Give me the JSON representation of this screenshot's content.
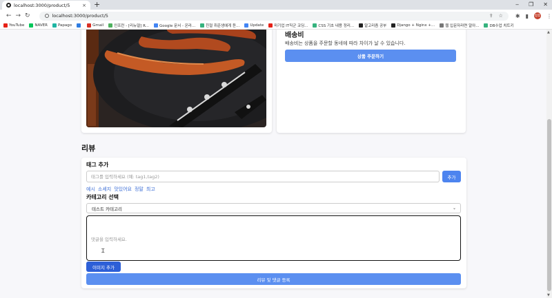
{
  "browser": {
    "tab_title": "localhost:3000/product/5",
    "tab_close": "×",
    "new_tab": "+",
    "url": "localhost:3000/product/5",
    "window_controls": [
      "‒",
      "❐",
      "✕"
    ],
    "profile_initials": "정후",
    "bookmarks": [
      {
        "label": "YouTube",
        "color": "#e62117"
      },
      {
        "label": "NAVER",
        "color": "#03c75a"
      },
      {
        "label": "Papago",
        "color": "#1fb5a3"
      },
      {
        "label": "",
        "color": "#2f7de1"
      },
      {
        "label": "Gmail",
        "color": "#d93025"
      },
      {
        "label": "인프런 - [리뉴얼] R...",
        "color": "#4fb15f"
      },
      {
        "label": "Google 문서 - 온라...",
        "color": "#4285f4"
      },
      {
        "label": "친절 취준생에게 듣...",
        "color": "#36b37e"
      },
      {
        "label": "Update",
        "color": "#4285f4"
      },
      {
        "label": "마기업 IT직군 코딩...",
        "color": "#e62117"
      },
      {
        "label": "CSS 기초 내용 정리...",
        "color": "#36b37e"
      },
      {
        "label": "알고리즘 공부",
        "color": "#222222"
      },
      {
        "label": "Django + Nginx +...",
        "color": "#222222"
      },
      {
        "label": "웹 입문자라면 알아...",
        "color": "#777777"
      },
      {
        "label": "DB수업 치트키",
        "color": "#36b37e"
      }
    ]
  },
  "shipping": {
    "title": "배송비",
    "desc": "배송비는 상품을 주문할 동네에 따라 차이가 날 수 있습니다.",
    "order_button": "상품 주문하기"
  },
  "review": {
    "heading": "리뷰",
    "tag_title": "태그 추가",
    "tag_placeholder": "태그를 입력하세요 (예: tag1,tag2)",
    "tag_add_button": "추가",
    "tags": [
      "예시",
      "소세지",
      "맛있어요",
      "정말",
      "최고"
    ],
    "category_title": "카테고리 선택",
    "category_selected": "테스트 카테고리",
    "comment_placeholder": "댓글을 입력하세요.",
    "image_add_button": "이미지 추가",
    "submit_button": "리뷰 및 댓글 등록"
  },
  "colors": {
    "primary": "#5b8ff0",
    "primary_dark": "#2d5fd7",
    "tag_link": "#3e6fd6"
  }
}
